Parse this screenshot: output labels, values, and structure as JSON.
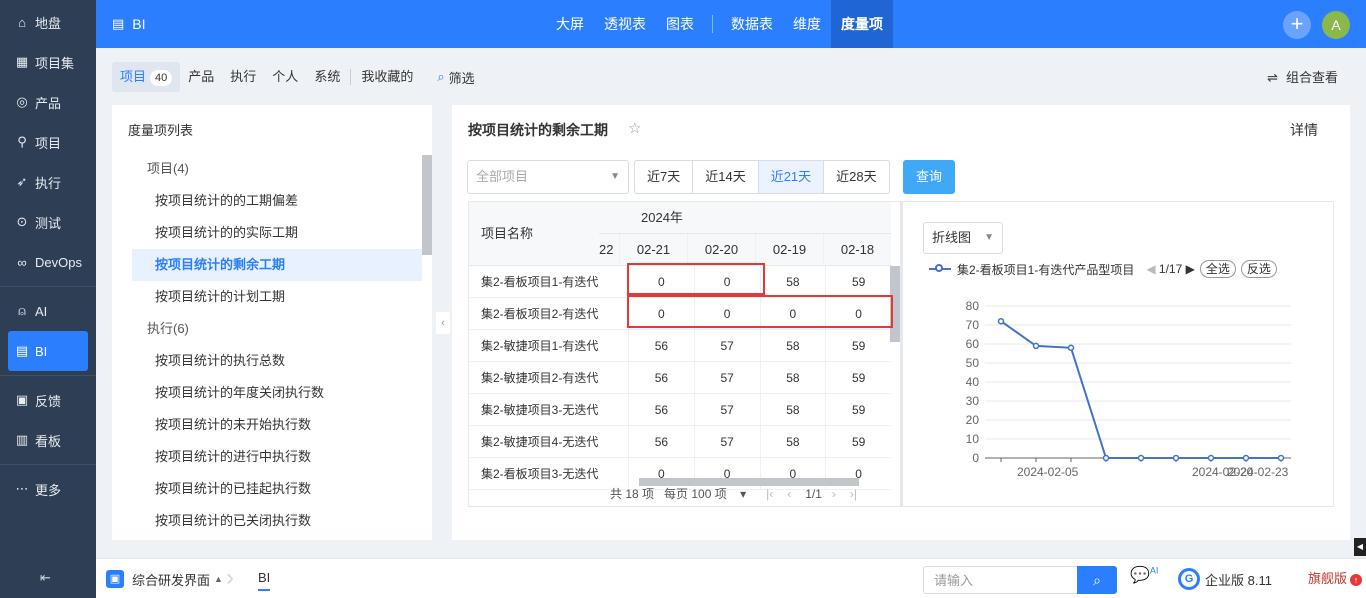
{
  "sidebar": {
    "items": [
      {
        "label": "地盘",
        "icon": "home-icon",
        "glyph": "⌂"
      },
      {
        "label": "项目集",
        "icon": "grid-icon",
        "glyph": "▦"
      },
      {
        "label": "产品",
        "icon": "bulb-icon",
        "glyph": "◎"
      },
      {
        "label": "项目",
        "icon": "rocket-icon",
        "glyph": "⚲"
      },
      {
        "label": "执行",
        "icon": "execute-icon",
        "glyph": "➶"
      },
      {
        "label": "测试",
        "icon": "test-icon",
        "glyph": "⊙"
      },
      {
        "label": "DevOps",
        "icon": "infinity-icon",
        "glyph": "∞"
      },
      {
        "label": "AI",
        "icon": "robot-icon",
        "glyph": "⍝"
      },
      {
        "label": "BI",
        "icon": "chart-board-icon",
        "glyph": "▤"
      },
      {
        "label": "反馈",
        "icon": "feedback-icon",
        "glyph": "▣"
      },
      {
        "label": "看板",
        "icon": "kanban-icon",
        "glyph": "▥"
      },
      {
        "label": "更多",
        "icon": "more-icon",
        "glyph": "⋯"
      }
    ],
    "collapse_glyph": "⇤"
  },
  "topbar": {
    "app_title": "BI",
    "tabs": [
      "大屏",
      "透视表",
      "图表",
      "数据表",
      "维度",
      "度量项"
    ],
    "plus": "+",
    "avatar": "A"
  },
  "subbar": {
    "tabs": [
      "项目",
      "产品",
      "执行",
      "个人",
      "系统",
      "我收藏的"
    ],
    "project_count": "40",
    "filter_label": "筛选",
    "combo_view": "组合查看"
  },
  "left_panel": {
    "title": "度量项列表",
    "groups": [
      {
        "label": "项目(4)",
        "items": [
          "按项目统计的的工期偏差",
          "按项目统计的的实际工期",
          "按项目统计的剩余工期",
          "按项目统计的计划工期"
        ]
      },
      {
        "label": "执行(6)",
        "items": [
          "按项目统计的执行总数",
          "按项目统计的年度关闭执行数",
          "按项目统计的未开始执行数",
          "按项目统计的进行中执行数",
          "按项目统计的已挂起执行数",
          "按项目统计的已关闭执行数"
        ]
      }
    ],
    "active_item": "按项目统计的剩余工期"
  },
  "main": {
    "title": "按项目统计的剩余工期",
    "detail": "详情",
    "project_select_placeholder": "全部项目",
    "ranges": [
      "近7天",
      "近14天",
      "近21天",
      "近28天"
    ],
    "active_range": "近21天",
    "query": "查询",
    "table": {
      "name_header": "项目名称",
      "year": "2024年",
      "stub_date": "22",
      "dates": [
        "02-21",
        "02-20",
        "02-19",
        "02-18"
      ],
      "rows": [
        {
          "name": "集2-看板项目1-有迭代",
          "values": [
            "0",
            "0",
            "58",
            "59"
          ]
        },
        {
          "name": "集2-看板项目2-有迭代",
          "values": [
            "0",
            "0",
            "0",
            "0"
          ]
        },
        {
          "name": "集2-敏捷项目1-有迭代",
          "values": [
            "56",
            "57",
            "58",
            "59"
          ]
        },
        {
          "name": "集2-敏捷项目2-有迭代",
          "values": [
            "56",
            "57",
            "58",
            "59"
          ]
        },
        {
          "name": "集2-敏捷项目3-无迭代",
          "values": [
            "56",
            "57",
            "58",
            "59"
          ]
        },
        {
          "name": "集2-敏捷项目4-无迭代",
          "values": [
            "56",
            "57",
            "58",
            "59"
          ]
        },
        {
          "name": "集2-看板项目3-无迭代",
          "values": [
            "0",
            "0",
            "0",
            "0"
          ]
        }
      ],
      "pager": {
        "total": "共 18 项",
        "per_page": "每页 100 项",
        "first": "|‹",
        "prev": "‹",
        "page": "1/1",
        "next": "›",
        "last": "›|"
      }
    },
    "chart": {
      "type_label": "折线图",
      "legend_name": "集2-看板项目1-有迭代产品型项目",
      "legend_page": "1/17",
      "select_all": "全选",
      "invert": "反选"
    }
  },
  "chart_data": {
    "type": "line",
    "x": [
      "2024-02-01",
      "2024-02-04",
      "2024-02-07",
      "2024-02-10",
      "2024-02-13",
      "2024-02-16",
      "2024-02-19",
      "2024-02-22",
      "2024-02-25"
    ],
    "series": [
      {
        "name": "集2-看板项目1-有迭代产品型项目",
        "values": [
          72,
          59,
          58,
          0,
          0,
          0,
          0,
          0,
          0
        ]
      }
    ],
    "x_tick_labels": [
      "2024-02-05",
      "2024-02-20",
      "2024-02-23"
    ],
    "y_ticks": [
      0,
      10,
      20,
      30,
      40,
      50,
      60,
      70,
      80
    ],
    "ylim": [
      0,
      80
    ],
    "grid": true,
    "color": "#4472c4"
  },
  "bottombar": {
    "workspace": "综合研发界面",
    "crumb": "BI",
    "search_placeholder": "请输入",
    "ai_sup": "AI",
    "edition": "企业版 8.11",
    "flagship": "旗舰版"
  }
}
